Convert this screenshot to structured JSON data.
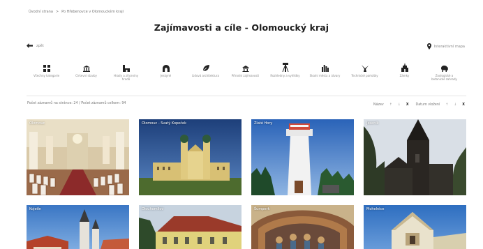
{
  "breadcrumb": {
    "home": "Úvodní strana",
    "separator": ">",
    "current": "Po Hřebenovce v Olomouckém kraji"
  },
  "page": {
    "title": "Zajímavosti a cíle - Olomoucký kraj"
  },
  "nav": {
    "back_label": "zpět",
    "map_label": "Interaktivní mapa"
  },
  "categories": [
    {
      "label": "Všechny kategorie",
      "icon": "grid-icon"
    },
    {
      "label": "Církevní stavby",
      "icon": "church-icon"
    },
    {
      "label": "Hrady a zřiceniny hradů",
      "icon": "castle-icon"
    },
    {
      "label": "Jeskyně",
      "icon": "cave-icon"
    },
    {
      "label": "Lidová architektura",
      "icon": "leaf-icon"
    },
    {
      "label": "Přírodní zajímavosti",
      "icon": "nature-icon"
    },
    {
      "label": "Rozhledny a vyhlídky",
      "icon": "lookout-tower-icon"
    },
    {
      "label": "Skalní města a útvary",
      "icon": "rocks-icon"
    },
    {
      "label": "Technické památky",
      "icon": "windmill-icon"
    },
    {
      "label": "Zámky",
      "icon": "chateau-icon"
    },
    {
      "label": "Zoologické a botanické zahrady",
      "icon": "elephant-icon"
    }
  ],
  "listing": {
    "per_page_label": "Počet záznamů na stránce: 24",
    "slash": "/",
    "total_label": "Počet záznamů celkem: 94"
  },
  "sort": {
    "name_label": "Název",
    "date_label": "Datum vložení",
    "asc_arrow": "↑",
    "desc_arrow": "↓",
    "clear": "X"
  },
  "cards": [
    {
      "name": "Olomouc"
    },
    {
      "name": "Olomouc - Svatý Kopeček"
    },
    {
      "name": "Zlaté Hory"
    },
    {
      "name": "Jeseník"
    },
    {
      "name": "Kojetín"
    },
    {
      "name": "Dlouhomilov"
    },
    {
      "name": "Šumperk"
    },
    {
      "name": "Mohelnice"
    }
  ],
  "colors": {
    "accent": "#222222",
    "muted": "#888888",
    "divider": "#e6e6e6"
  }
}
